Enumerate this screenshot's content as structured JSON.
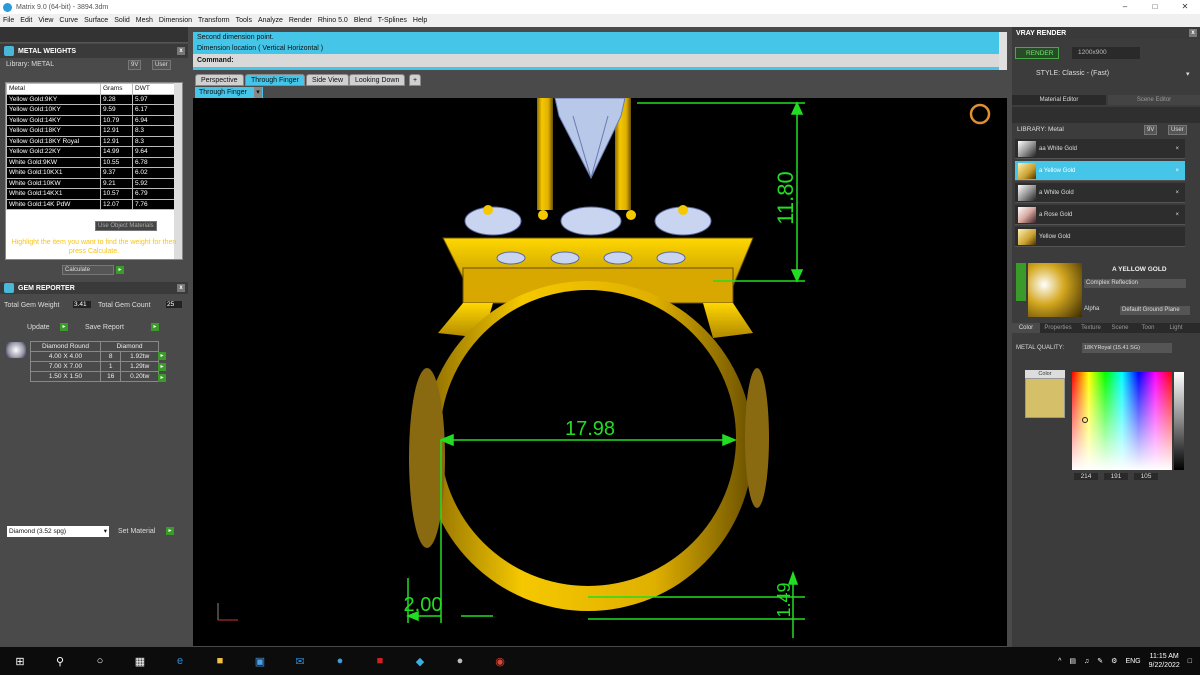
{
  "window": {
    "title": "Matrix 9.0 (64-bit) - 3894.3dm"
  },
  "menu": [
    "File",
    "Edit",
    "View",
    "Curve",
    "Surface",
    "Solid",
    "Mesh",
    "Dimension",
    "Transform",
    "Tools",
    "Analyze",
    "Render",
    "Rhino 5.0",
    "Blend",
    "T-Splines",
    "Help"
  ],
  "metal_weights": {
    "title": "METAL WEIGHTS",
    "library_label": "Library: METAL",
    "library_btns": [
      "9V",
      "User"
    ],
    "columns": [
      "Metal",
      "Grams",
      "DWT"
    ],
    "rows": [
      [
        "Yellow Gold:9KY",
        "9.28",
        "5.97"
      ],
      [
        "Yellow Gold:10KY",
        "9.59",
        "6.17"
      ],
      [
        "Yellow Gold:14KY",
        "10.79",
        "6.94"
      ],
      [
        "Yellow Gold:18KY",
        "12.91",
        "8.3"
      ],
      [
        "Yellow Gold:18KY Royal",
        "12.91",
        "8.3"
      ],
      [
        "Yellow Gold:22KY",
        "14.99",
        "9.64"
      ],
      [
        "White Gold:9KW",
        "10.55",
        "6.78"
      ],
      [
        "White Gold:10KX1",
        "9.37",
        "6.02"
      ],
      [
        "White Gold:10KW",
        "9.21",
        "5.92"
      ],
      [
        "White Gold:14KX1",
        "10.57",
        "6.79"
      ],
      [
        "White Gold:14K PdW",
        "12.07",
        "7.76"
      ]
    ],
    "use_object_materials": "Use Object Materials",
    "hint": "Highlight the item you want to find the weight for then press Calculate.",
    "calculate": "Calculate"
  },
  "gem_reporter": {
    "title": "GEM REPORTER",
    "total_gem_weight_label": "Total Gem Weight",
    "total_gem_weight": "3.41",
    "total_gem_count_label": "Total Gem Count",
    "total_gem_count": "25",
    "update": "Update",
    "save_report": "Save Report",
    "header": [
      "Diamond Round",
      "Diamond"
    ],
    "rows": [
      [
        "4.00 X 4.00",
        "8",
        "1.92tw"
      ],
      [
        "7.00 X 7.00",
        "1",
        "1.29tw"
      ],
      [
        "1.50 X 1.50",
        "16",
        "0.20tw"
      ]
    ],
    "material_select": "Diamond   (3.52 spg)",
    "set_material": "Set Material"
  },
  "command": {
    "line1": "Second dimension point.",
    "line2": "Dimension location ( Vertical  Horizontal )",
    "label": "Command:"
  },
  "view_tabs": [
    "Perspective",
    "Through Finger",
    "Side View",
    "Looking Down"
  ],
  "active_view": "Through Finger",
  "dimensions": {
    "height": "11.80",
    "inner": "17.98",
    "bottom_left": "2.00",
    "bottom_right": "1.49"
  },
  "vray": {
    "title": "VRAY RENDER",
    "render": "RENDER",
    "resolution": "1200x900",
    "style": "STYLE:  Classic - (Fast)",
    "tabs": [
      "Material Editor",
      "Scene Editor"
    ],
    "library": "LIBRARY: Metal",
    "library_btns": [
      "9V",
      "User"
    ],
    "materials": [
      "aa White Gold",
      "a Yellow Gold",
      "a White Gold",
      "a Rose Gold",
      "Yellow Gold"
    ],
    "preview_name": "A YELLOW GOLD",
    "reflection": "Complex Reflection",
    "alpha": "Alpha",
    "ground": "Default Ground Plane",
    "editor_tabs": [
      "Color",
      "Properties",
      "Texture",
      "Scene",
      "Toon",
      "Light"
    ],
    "metal_quality_label": "METAL QUALITY:",
    "metal_quality": "18KYRoyal    (15.41 SG)",
    "color_label": "Color",
    "rgb": [
      "214",
      "191",
      "105"
    ],
    "swatch_color": "#d6bf69"
  },
  "taskbar": {
    "lang": "ENG",
    "time": "11:15 AM",
    "date": "9/22/2022"
  }
}
